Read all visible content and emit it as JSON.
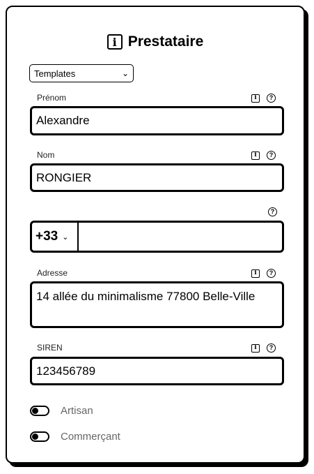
{
  "header": {
    "title": "Prestataire",
    "icon": "info-square-icon"
  },
  "templates": {
    "selected": "Templates",
    "chevron": "⌄"
  },
  "fields": {
    "prenom": {
      "label": "Prénom",
      "value": "Alexandre"
    },
    "nom": {
      "label": "Nom",
      "value": "RONGIER"
    },
    "phone": {
      "country_code": "+33",
      "value": ""
    },
    "adresse": {
      "label": "Adresse",
      "value": "14 allée du minimalisme 77800 Belle-Ville"
    },
    "siren": {
      "label": "SIREN",
      "value": "123456789"
    }
  },
  "icons": {
    "info": "i",
    "help": "?"
  },
  "toggles": [
    {
      "label": "Artisan",
      "on": false
    },
    {
      "label": "Commerçant",
      "on": false
    }
  ]
}
